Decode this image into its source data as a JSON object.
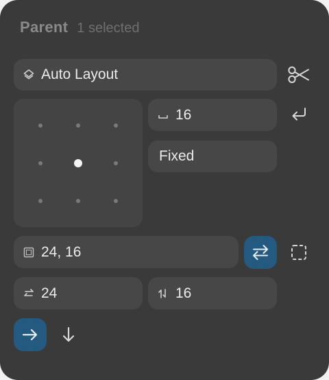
{
  "header": {
    "title": "Parent",
    "subtitle": "1 selected"
  },
  "layout_row": {
    "label": "Auto Layout",
    "icon": "layers-icon",
    "remove_icon": "scissors-icon"
  },
  "alignment": {
    "selected": "center",
    "rows": 3,
    "cols": 3
  },
  "gap": {
    "value": "16",
    "icon": "gap-icon",
    "action_icon": "return-icon"
  },
  "sizing": {
    "value": "Fixed"
  },
  "padding": {
    "value": "24, 16",
    "icon": "padding-icon",
    "toggle_icon": "swap-arrows-icon",
    "toggle_active": true,
    "individual_icon": "dashed-square-icon"
  },
  "padding_h": {
    "value": "24",
    "icon": "horizontal-arrows-icon"
  },
  "padding_v": {
    "value": "16",
    "icon": "vertical-arrows-icon"
  },
  "direction": {
    "options": [
      "right-arrow-icon",
      "down-arrow-icon"
    ],
    "selected": "right-arrow-icon"
  },
  "colors": {
    "panel": "#3a3a3a",
    "field": "#474747",
    "accent": "#245a80",
    "text": "#ececec",
    "muted": "#8a8a8a"
  }
}
